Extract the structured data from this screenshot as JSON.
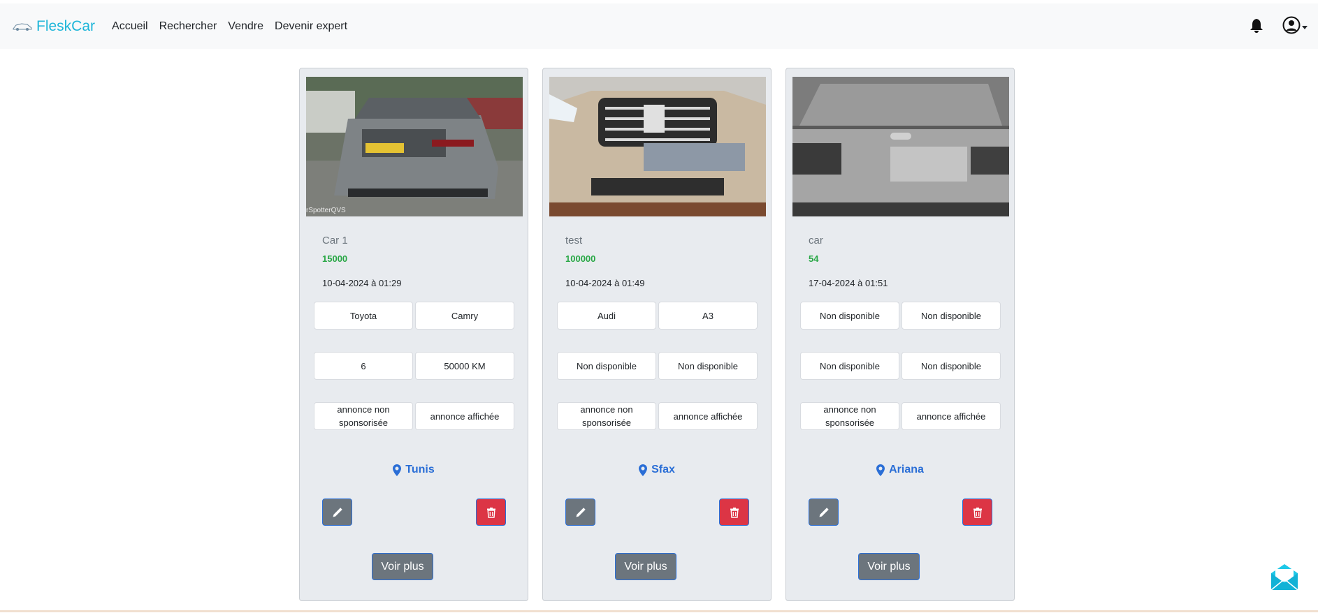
{
  "nav": {
    "brand": "FleskCar",
    "links": [
      "Accueil",
      "Rechercher",
      "Vendre",
      "Devenir expert"
    ]
  },
  "colors": {
    "brand": "#1fb6d9",
    "price": "#28a745",
    "location": "#2a6ed6",
    "edit": "#6c757d",
    "delete": "#dc3545"
  },
  "cards": [
    {
      "title": "Car 1",
      "price": "15000",
      "date": "10-04-2024 à 01:29",
      "row1": [
        "Toyota",
        "Camry"
      ],
      "row2": [
        "6",
        "50000 KM"
      ],
      "row3": [
        "annonce non sponsorisée",
        "annonce affichée"
      ],
      "location": "Tunis",
      "button": "Voir plus",
      "watermark": "rSpotterQVS"
    },
    {
      "title": "test",
      "price": "100000",
      "date": "10-04-2024 à 01:49",
      "row1": [
        "Audi",
        "A3"
      ],
      "row2": [
        "Non disponible",
        "Non disponible"
      ],
      "row3": [
        "annonce non sponsorisée",
        "annonce affichée"
      ],
      "location": "Sfax",
      "button": "Voir plus"
    },
    {
      "title": "car",
      "price": "54",
      "date": "17-04-2024 à 01:51",
      "row1": [
        "Non disponible",
        "Non disponible"
      ],
      "row2": [
        "Non disponible",
        "Non disponible"
      ],
      "row3": [
        "annonce non sponsorisée",
        "annonce affichée"
      ],
      "location": "Ariana",
      "button": "Voir plus"
    }
  ]
}
